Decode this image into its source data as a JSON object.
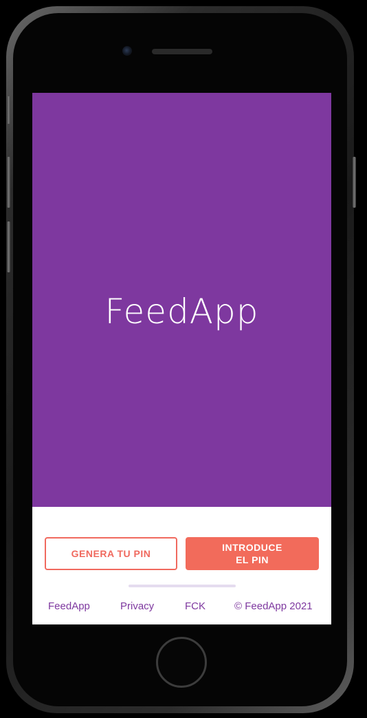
{
  "splash": {
    "logo_text": "FeedApp",
    "background_color": "#7e389f"
  },
  "actions": {
    "generate_pin_label": "GENERA TU PIN",
    "enter_pin_label": "INTRODUCE EL PIN",
    "accent_color": "#f26b5b"
  },
  "footer": {
    "brand_link": "FeedApp",
    "privacy_link": "Privacy",
    "fck_link": "FCK",
    "copyright": "© FeedApp 2021"
  }
}
